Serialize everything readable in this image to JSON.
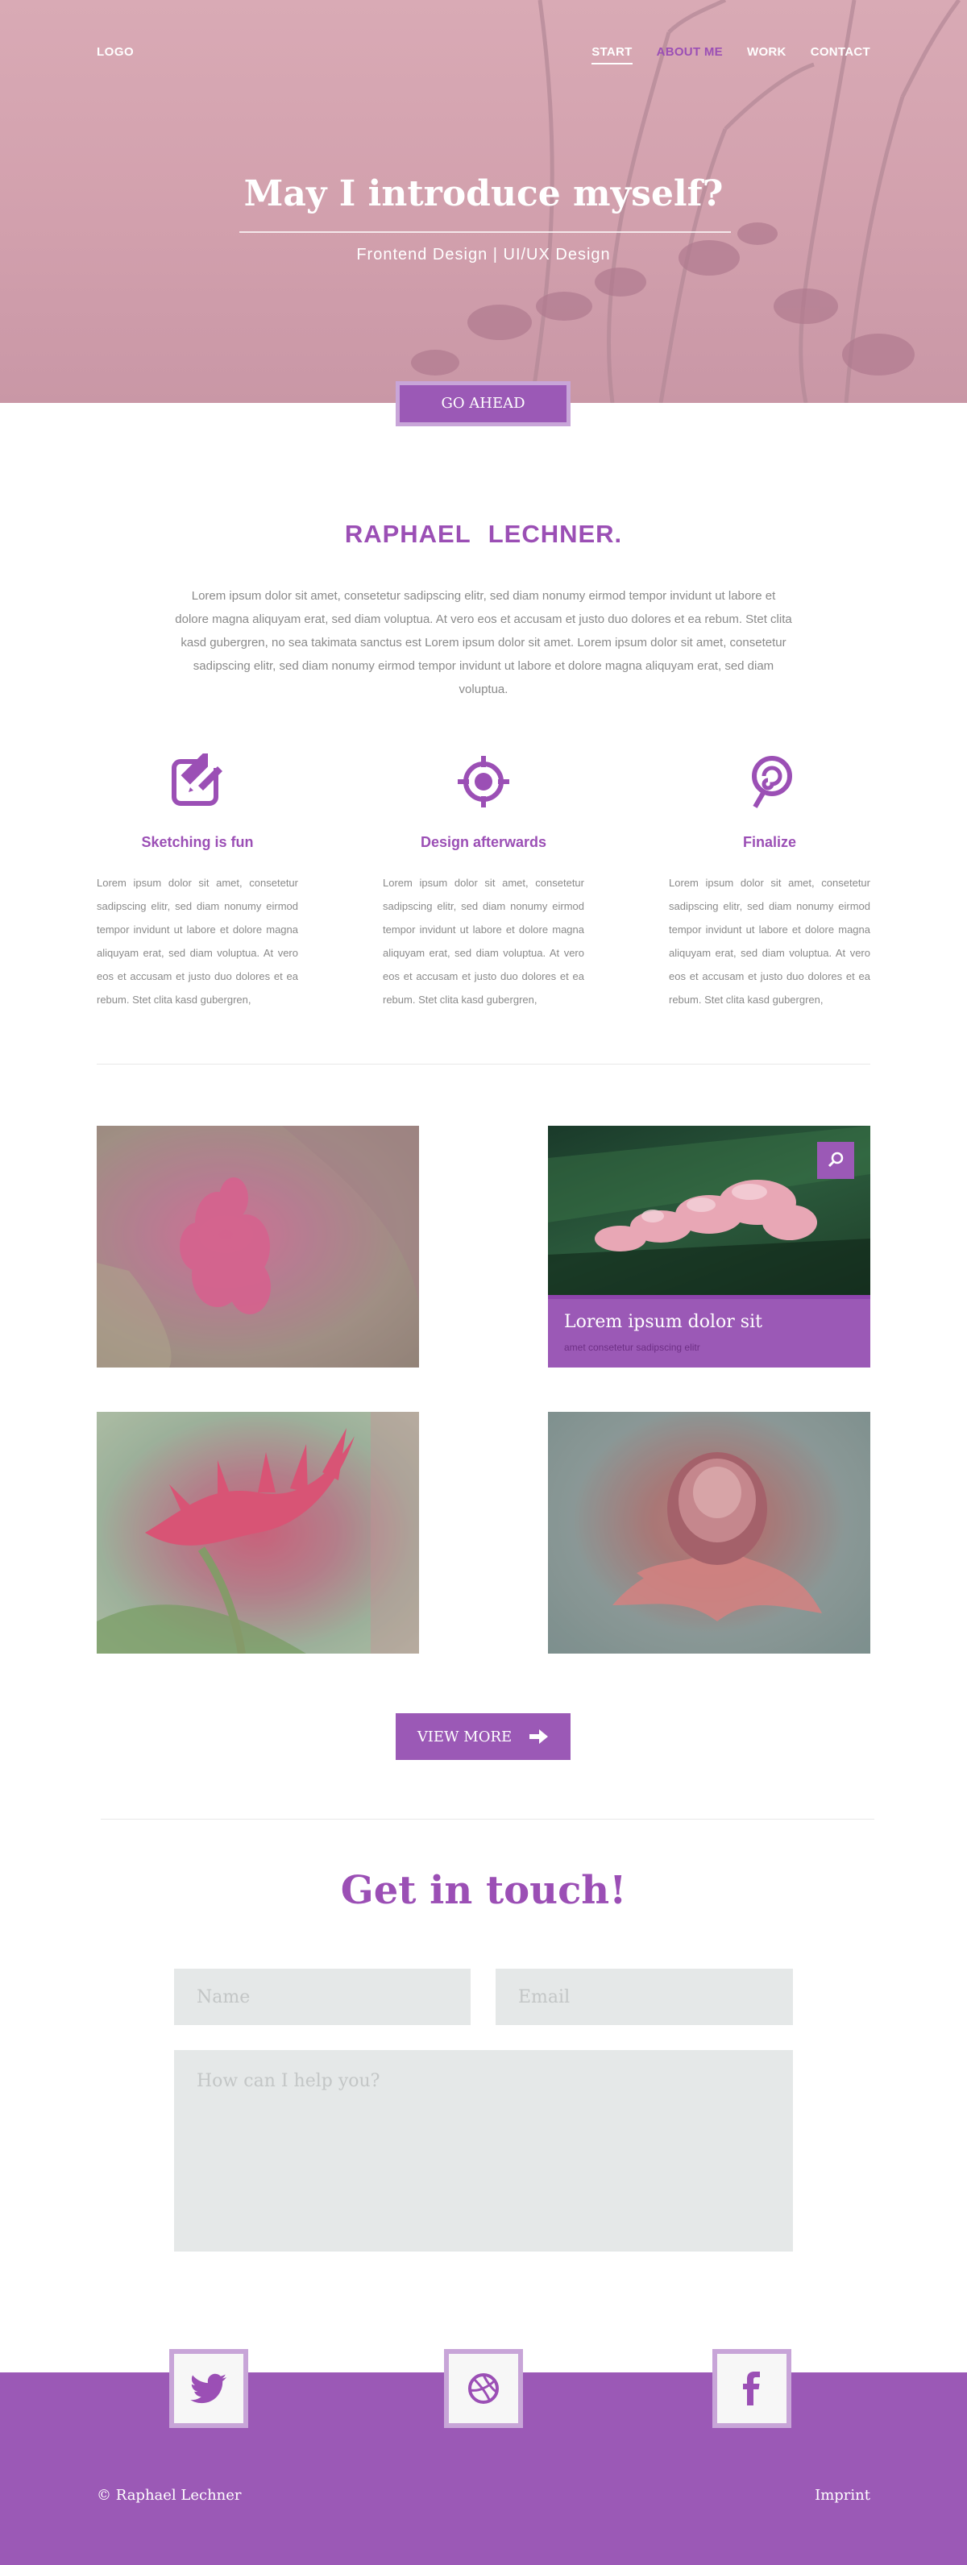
{
  "header": {
    "logo": "LOGO",
    "nav": [
      {
        "label": "START"
      },
      {
        "label": "ABOUT ME"
      },
      {
        "label": "WORK"
      },
      {
        "label": "CONTACT"
      }
    ]
  },
  "hero": {
    "title": "May I introduce myself?",
    "subtitle": "Frontend Design | UI/UX Design",
    "button": "GO AHEAD"
  },
  "about": {
    "name": "RAPHAEL LECHNER.",
    "intro": "Lorem ipsum dolor sit amet, consetetur sadipscing elitr, sed diam nonumy eirmod tempor invidunt ut labore et dolore magna aliquyam erat, sed diam voluptua. At vero eos et accusam et justo duo dolores et ea rebum. Stet clita kasd gubergren, no sea takimata sanctus est Lorem ipsum dolor sit amet. Lorem ipsum dolor sit amet, consetetur sadipscing elitr, sed diam nonumy eirmod tempor invidunt ut labore et dolore magna aliquyam erat, sed diam voluptua.",
    "features": [
      {
        "icon": "pencil-edit-icon",
        "title": "Sketching is fun",
        "text": "Lorem ipsum dolor sit amet, consetetur sadipscing elitr, sed diam nonumy eirmod tempor invidunt ut labore et dolore magna aliquyam erat, sed diam voluptua. At vero eos et accusam et justo duo dolores et ea rebum. Stet clita kasd gubergren,"
      },
      {
        "icon": "target-icon",
        "title": "Design afterwards",
        "text": "Lorem ipsum dolor sit amet, consetetur sadipscing elitr, sed diam nonumy eirmod tempor invidunt ut labore et dolore magna aliquyam erat, sed diam voluptua. At vero eos et accusam et justo duo dolores et ea rebum. Stet clita kasd gubergren,"
      },
      {
        "icon": "lollipop-icon",
        "title": "Finalize",
        "text": "Lorem ipsum dolor sit amet, consetetur sadipscing elitr, sed diam nonumy eirmod tempor invidunt ut labore et dolore magna aliquyam erat, sed diam voluptua. At vero eos et accusam et justo duo dolores et ea rebum. Stet clita kasd gubergren,"
      }
    ]
  },
  "work": {
    "hover_title": "Lorem ipsum dolor sit",
    "hover_subtitle": "amet consetetur sadipscing elitr",
    "view_more": "VIEW MORE"
  },
  "contact": {
    "title": "Get in touch!",
    "name_placeholder": "Name",
    "email_placeholder": "Email",
    "message_placeholder": "How can I help you?"
  },
  "footer": {
    "social": [
      "twitter-icon",
      "dribbble-icon",
      "facebook-icon"
    ],
    "copyright": "© Raphael Lechner",
    "imprint": "Imprint"
  },
  "colors": {
    "accent": "#9b59b6",
    "accent_light": "#c8a5d8",
    "hero_pink": "#d2a0ad",
    "field_gray": "#e5e8e8"
  }
}
